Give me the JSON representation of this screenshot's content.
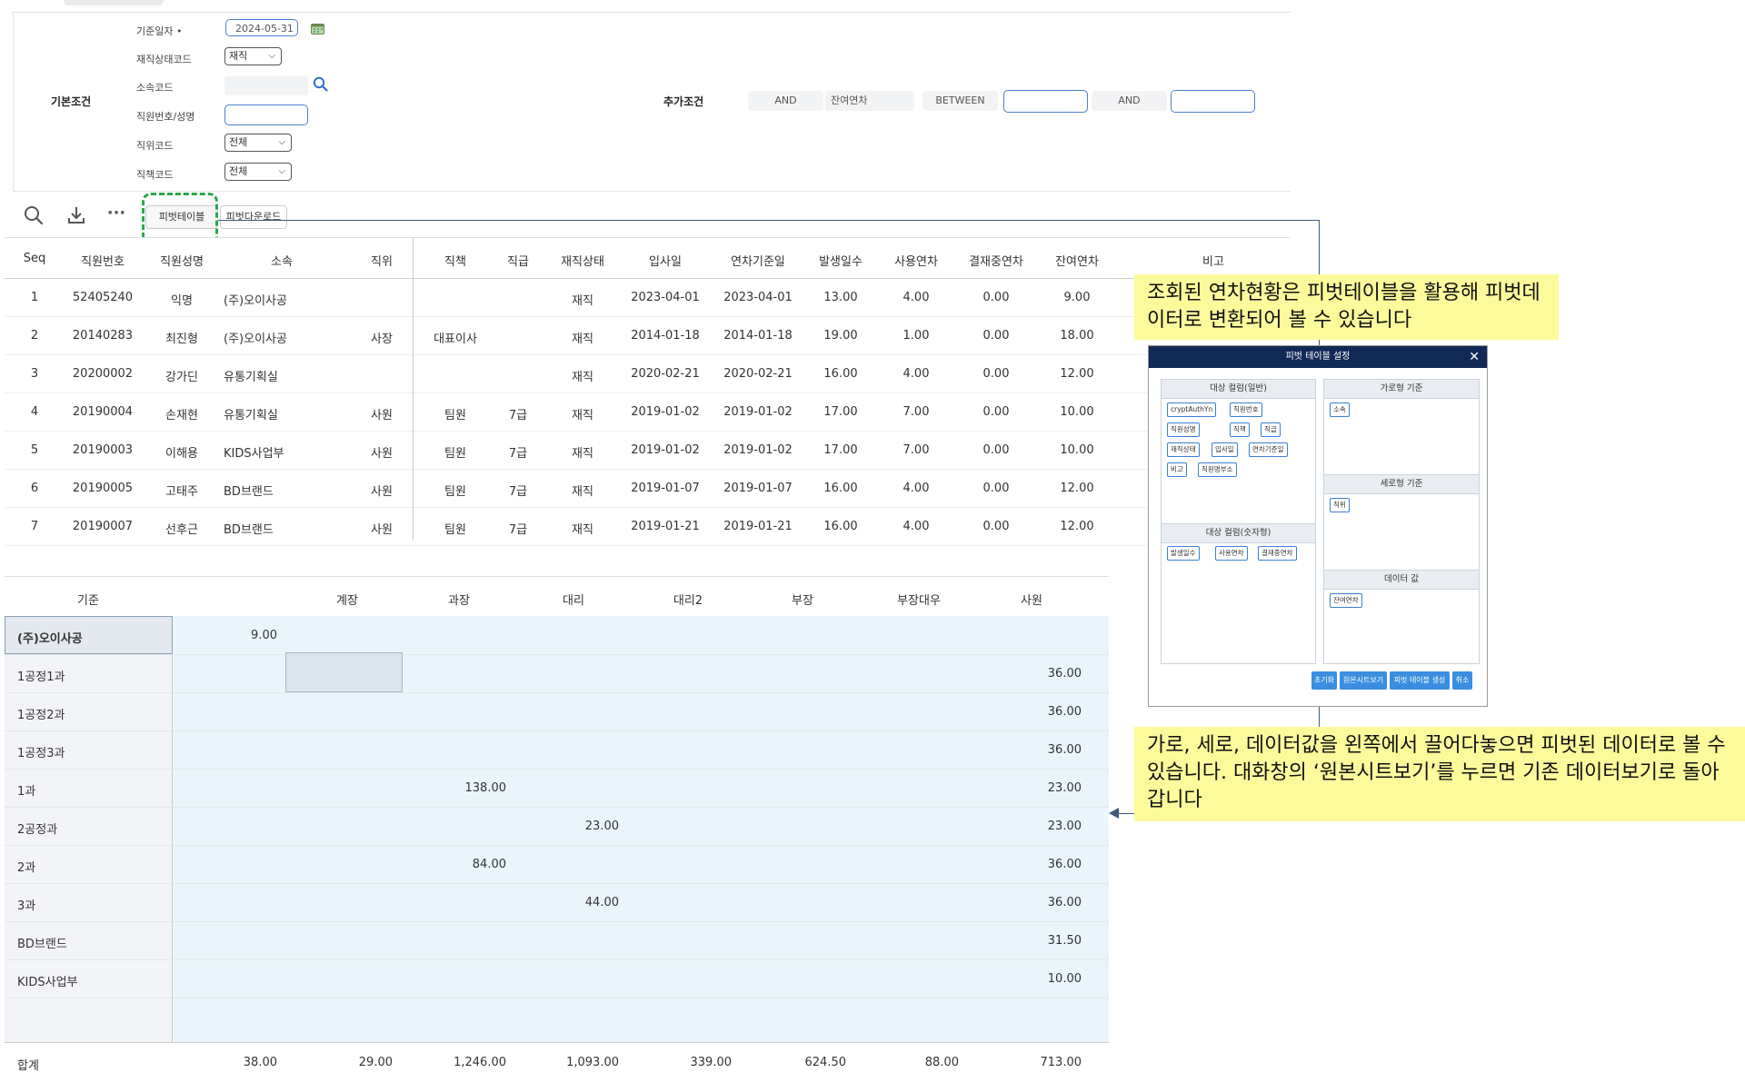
{
  "search": {
    "basic_label": "기본조건",
    "extra_label": "추가조건",
    "date_label": "기준일자 •",
    "date_value": "2024-05-31",
    "status_label": "재직상태코드",
    "status_value": "재직",
    "dept_label": "소속코드",
    "emp_label": "직원번호/성명",
    "pos_label": "직위코드",
    "pos_value": "전체",
    "duty_label": "직책코드",
    "duty_value": "전체",
    "extra_and1": "AND",
    "extra_field": "잔여연차",
    "extra_between": "BETWEEN",
    "extra_and2": "AND"
  },
  "toolbar": {
    "pivot_table": "피벗테이블",
    "pivot_download": "피벗다운로드",
    "more": "···"
  },
  "grid": {
    "headers": [
      "Seq",
      "직원번호",
      "직원성명",
      "소속",
      "직위",
      "직책",
      "직급",
      "재직상태",
      "입사일",
      "연차기준일",
      "발생일수",
      "사용연차",
      "결재중연차",
      "잔여연차",
      "비고"
    ],
    "rows": [
      [
        "1",
        "52405240",
        "익명",
        "(주)오이사공",
        "",
        "",
        "",
        "재직",
        "2023-04-01",
        "2023-04-01",
        "13.00",
        "4.00",
        "0.00",
        "9.00",
        ""
      ],
      [
        "2",
        "20140283",
        "최진형",
        "(주)오이사공",
        "사장",
        "대표이사",
        "",
        "재직",
        "2014-01-18",
        "2014-01-18",
        "19.00",
        "1.00",
        "0.00",
        "18.00",
        ""
      ],
      [
        "3",
        "20200002",
        "강가딘",
        "유통기획실",
        "",
        "",
        "",
        "재직",
        "2020-02-21",
        "2020-02-21",
        "16.00",
        "4.00",
        "0.00",
        "12.00",
        ""
      ],
      [
        "4",
        "20190004",
        "손재현",
        "유통기획실",
        "사원",
        "팀원",
        "7급",
        "재직",
        "2019-01-02",
        "2019-01-02",
        "17.00",
        "7.00",
        "0.00",
        "10.00",
        ""
      ],
      [
        "5",
        "20190003",
        "이해용",
        "KIDS사업부",
        "사원",
        "팀원",
        "7급",
        "재직",
        "2019-01-02",
        "2019-01-02",
        "17.00",
        "7.00",
        "0.00",
        "10.00",
        ""
      ],
      [
        "6",
        "20190005",
        "고태주",
        "BD브랜드",
        "사원",
        "팀원",
        "7급",
        "재직",
        "2019-01-07",
        "2019-01-07",
        "16.00",
        "4.00",
        "0.00",
        "12.00",
        ""
      ],
      [
        "7",
        "20190007",
        "선후근",
        "BD브랜드",
        "사원",
        "팀원",
        "7급",
        "재직",
        "2019-01-21",
        "2019-01-21",
        "16.00",
        "4.00",
        "0.00",
        "12.00",
        ""
      ]
    ]
  },
  "pivot": {
    "corner": "기준",
    "columns": [
      "계장",
      "과장",
      "대리",
      "대리2",
      "부장",
      "부장대우",
      "사원"
    ],
    "rows": [
      {
        "label": "(주)오이사공",
        "vals": [
          "9.00",
          "",
          "",
          "",
          "",
          "",
          ""
        ]
      },
      {
        "label": "1공정1과",
        "vals": [
          "",
          "",
          "",
          "",
          "",
          "",
          "36.00"
        ]
      },
      {
        "label": "1공정2과",
        "vals": [
          "",
          "",
          "",
          "",
          "",
          "",
          "36.00"
        ]
      },
      {
        "label": "1공정3과",
        "vals": [
          "",
          "",
          "",
          "",
          "",
          "",
          "36.00"
        ]
      },
      {
        "label": "1과",
        "vals": [
          "",
          "138.00",
          "",
          "",
          "",
          "",
          "23.00"
        ]
      },
      {
        "label": "2공정과",
        "vals": [
          "",
          "",
          "23.00",
          "",
          "",
          "",
          "23.00"
        ]
      },
      {
        "label": "2과",
        "vals": [
          "",
          "84.00",
          "",
          "",
          "",
          "",
          "36.00"
        ]
      },
      {
        "label": "3과",
        "vals": [
          "",
          "",
          "44.00",
          "",
          "",
          "",
          "36.00"
        ]
      },
      {
        "label": "BD브랜드",
        "vals": [
          "",
          "",
          "",
          "",
          "",
          "",
          "31.50"
        ]
      },
      {
        "label": "KIDS사업부",
        "vals": [
          "",
          "",
          "",
          "",
          "",
          "",
          "10.00"
        ]
      }
    ],
    "total_label": "합계",
    "totals": [
      "38.00",
      "29.00",
      "1,246.00",
      "1,093.00",
      "339.00",
      "624.50",
      "88.00",
      "713.00"
    ]
  },
  "dialog": {
    "title": "피벗 테이블 설정",
    "close": "✕",
    "general_header": "대상 컬럼(일반)",
    "general_chips": [
      "cryptAuthYn",
      "직원번호",
      "직원성명",
      "직책",
      "직급",
      "재직상태",
      "입사일",
      "연차기준일",
      "비고",
      "직원명부소"
    ],
    "numeric_header": "대상 컬럼(숫자형)",
    "numeric_chips": [
      "발생일수",
      "사용연차",
      "결재중연차"
    ],
    "row_header": "가로형 기준",
    "row_chips": [
      "소속"
    ],
    "col_header": "세로형 기준",
    "col_chips": [
      "직위"
    ],
    "data_header": "데이터 값",
    "data_chips": [
      "잔여연차"
    ],
    "buttons": [
      "초기화",
      "원본시트보기",
      "피벗 테이블 생성",
      "취소"
    ]
  },
  "callouts": {
    "top": "조회된 연차현황은 피벗테이블을 활용해 피벗데이터로 변환되어 볼 수 있습니다",
    "bottom": "가로, 세로, 데이터값을 왼쪽에서 끌어다놓으면 피벗된 데이터로 볼 수 있습니다. 대화창의 ‘원본시트보기’를 누르면 기존 데이터보기로 돌아갑니다"
  },
  "colors": {
    "accent": "#4a7fd0",
    "highlight": "#2aa84a",
    "callout_bg": "#fdfa9c",
    "dialog_title": "#102a55",
    "pivot_body": "#eaf5fb"
  }
}
